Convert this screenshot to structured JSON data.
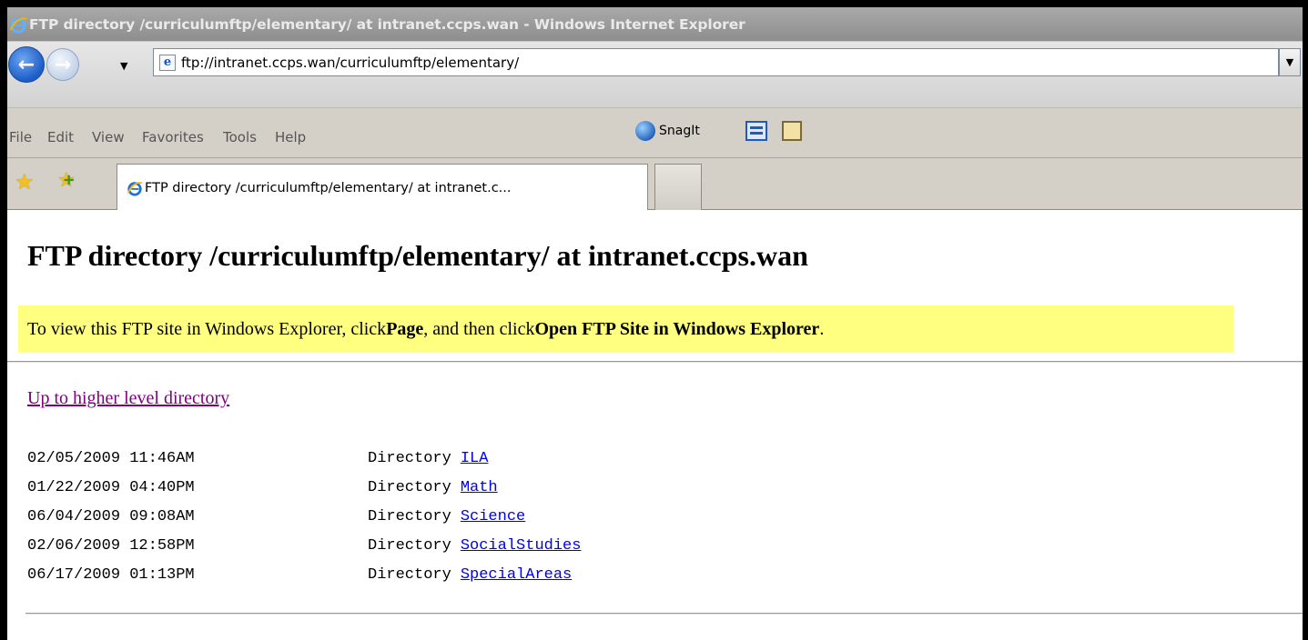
{
  "window": {
    "title": "FTP directory /curriculumftp/elementary/ at intranet.ccps.wan - Windows Internet Explorer"
  },
  "address": {
    "url": "ftp://intranet.ccps.wan/curriculumftp/elementary/"
  },
  "menu": {
    "file": "File",
    "edit": "Edit",
    "view": "View",
    "favorites": "Favorites",
    "tools": "Tools",
    "help": "Help",
    "snagit": "SnagIt"
  },
  "tab": {
    "label": "FTP directory /curriculumftp/elementary/ at intranet.c..."
  },
  "page": {
    "heading": "FTP directory /curriculumftp/elementary/ at intranet.ccps.wan",
    "note_prefix": "To view this FTP site in Windows Explorer, click ",
    "note_bold1": "Page",
    "note_middle": ", and then click ",
    "note_bold2": "Open FTP Site in Windows Explorer",
    "note_suffix": ".",
    "up_link": "Up to higher level directory",
    "entries": [
      {
        "datetime": "02/05/2009 11:46AM",
        "type": "Directory",
        "name": "ILA"
      },
      {
        "datetime": "01/22/2009 04:40PM",
        "type": "Directory",
        "name": "Math"
      },
      {
        "datetime": "06/04/2009 09:08AM",
        "type": "Directory",
        "name": "Science"
      },
      {
        "datetime": "02/06/2009 12:58PM",
        "type": "Directory",
        "name": "SocialStudies"
      },
      {
        "datetime": "06/17/2009 01:13PM",
        "type": "Directory",
        "name": "SpecialAreas"
      }
    ]
  },
  "icons": {
    "browser": "internet-explorer-icon",
    "back": "back-arrow-icon",
    "forward": "forward-arrow-icon",
    "favorites": "favorites-star-icon",
    "add_favorite": "add-favorite-icon",
    "snagit": "snagit-icon"
  },
  "colors": {
    "note_background": "#ffff80",
    "visited_link": "#800080",
    "link": "#0000ee",
    "titlebar": "#999999"
  }
}
